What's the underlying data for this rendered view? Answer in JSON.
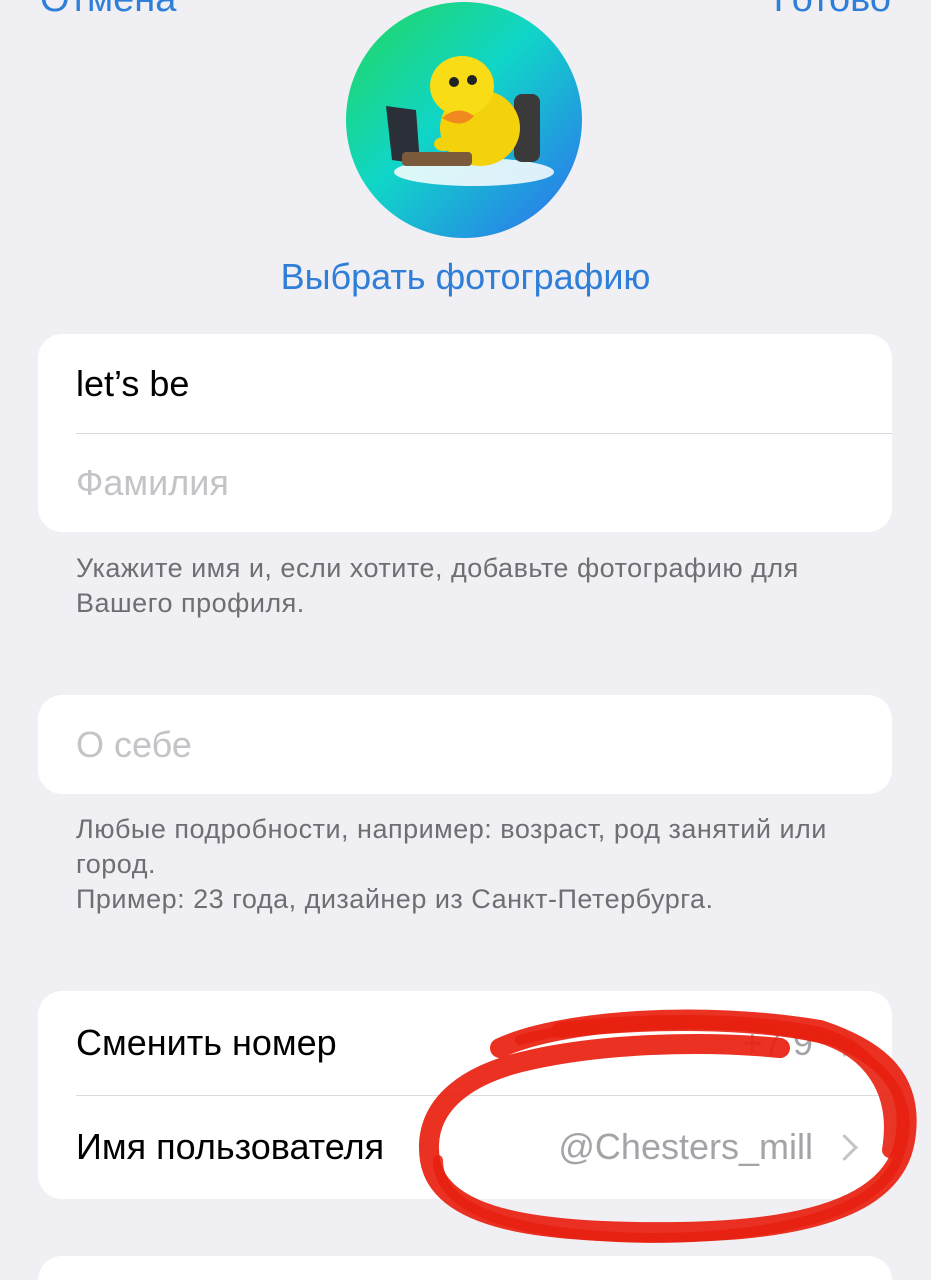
{
  "nav": {
    "cancel_label": "Отмена",
    "done_label": "Готово"
  },
  "profile": {
    "choose_photo_label": "Выбрать фотографию"
  },
  "name_section": {
    "first_name_value": "let’s be",
    "last_name_placeholder": "Фамилия",
    "hint": "Укажите имя и, если хотите, добавьте фотографию для Вашего профиля."
  },
  "bio_section": {
    "bio_placeholder": "О себе",
    "hint_line1": "Любые подробности, например: возраст, род занятий или город.",
    "hint_line2": "Пример: 23 года, дизайнер из Санкт-Петербурга."
  },
  "account_section": {
    "change_number_label": "Сменить номер",
    "change_number_value": "+7 9",
    "username_label": "Имя пользователя",
    "username_value": "@Chesters_mill"
  },
  "colors": {
    "accent": "#2f7ed8",
    "background": "#efeff4",
    "annotation": "#e8200f"
  },
  "icons": {
    "row_chevron": "chevron-right-icon"
  }
}
